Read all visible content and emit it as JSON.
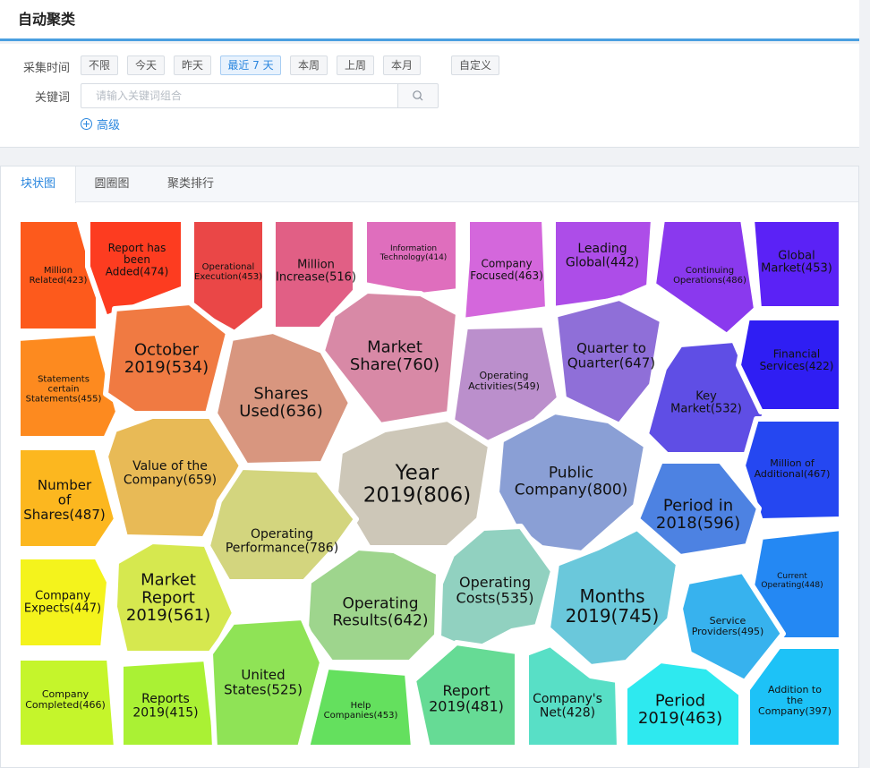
{
  "header": {
    "title": "自动聚类"
  },
  "filters": {
    "time_label": "采集时间",
    "time_options": [
      "不限",
      "今天",
      "昨天",
      "最近 7 天",
      "本周",
      "上周",
      "本月",
      "自定义"
    ],
    "selected_time": "最近 7 天",
    "keyword_label": "关键词",
    "keyword_placeholder": "请输入关键词组合",
    "keyword_value": "",
    "advanced_label": "高级"
  },
  "tabs": [
    {
      "label": "块状图",
      "active": true
    },
    {
      "label": "圆圈图",
      "active": false
    },
    {
      "label": "聚类排行",
      "active": false
    }
  ],
  "clusters": [
    {
      "label": "Million Related(423)",
      "count": 423,
      "color": "#fd5a1c"
    },
    {
      "label": "Report has been Added(474)",
      "count": 474,
      "color": "#fd3c20"
    },
    {
      "label": "Operational Execution(453)",
      "count": 453,
      "color": "#ea4747"
    },
    {
      "label": "Million Increase(516)",
      "count": 516,
      "color": "#e15f85"
    },
    {
      "label": "Information Technology(414)",
      "count": 414,
      "color": "#df6ebd"
    },
    {
      "label": "Company Focused(463)",
      "count": 463,
      "color": "#d467dc"
    },
    {
      "label": "Leading Global(442)",
      "count": 442,
      "color": "#ad4de8"
    },
    {
      "label": "Continuing Operations(486)",
      "count": 486,
      "color": "#8a39ee"
    },
    {
      "label": "Global Market(453)",
      "count": 453,
      "color": "#5b22f6"
    },
    {
      "label": "Statements certain Statements(455)",
      "count": 455,
      "color": "#fd8a1f"
    },
    {
      "label": "October 2019(534)",
      "count": 534,
      "color": "#f07a42"
    },
    {
      "label": "Shares Used(636)",
      "count": 636,
      "color": "#d8967f"
    },
    {
      "label": "Market Share(760)",
      "count": 760,
      "color": "#d889a6"
    },
    {
      "label": "Operating Activities(549)",
      "count": 549,
      "color": "#bb8fcc"
    },
    {
      "label": "Quarter to Quarter(647)",
      "count": 647,
      "color": "#8f6fd8"
    },
    {
      "label": "Key Market(532)",
      "count": 532,
      "color": "#5f4ee5"
    },
    {
      "label": "Financial Services(422)",
      "count": 422,
      "color": "#2f1ef3"
    },
    {
      "label": "Number of Shares(487)",
      "count": 487,
      "color": "#fcb71f"
    },
    {
      "label": "Value of the Company(659)",
      "count": 659,
      "color": "#e8ba56"
    },
    {
      "label": "Year 2019(806)",
      "count": 806,
      "color": "#cdc7b8"
    },
    {
      "label": "Public Company(800)",
      "count": 800,
      "color": "#8a9fd5"
    },
    {
      "label": "Million of Additional(467)",
      "count": 467,
      "color": "#2547f1"
    },
    {
      "label": "Operating Performance(786)",
      "count": 786,
      "color": "#d3d57e"
    },
    {
      "label": "Period in 2018(596)",
      "count": 596,
      "color": "#4d82e2"
    },
    {
      "label": "Company Expects(447)",
      "count": 447,
      "color": "#f4f31c"
    },
    {
      "label": "Market Report 2019(561)",
      "count": 561,
      "color": "#d6e84f"
    },
    {
      "label": "Operating Results(642)",
      "count": 642,
      "color": "#9ed58d"
    },
    {
      "label": "Operating Costs(535)",
      "count": 535,
      "color": "#91d1c0"
    },
    {
      "label": "Months 2019(745)",
      "count": 745,
      "color": "#6ac8db"
    },
    {
      "label": "Current Operating(448)",
      "count": 448,
      "color": "#2488f3"
    },
    {
      "label": "Service Providers(495)",
      "count": 495,
      "color": "#37b2ee"
    },
    {
      "label": "Company Completed(466)",
      "count": 466,
      "color": "#c5f52b"
    },
    {
      "label": "Reports 2019(415)",
      "count": 415,
      "color": "#aaf134"
    },
    {
      "label": "United States(525)",
      "count": 525,
      "color": "#8fe356"
    },
    {
      "label": "Help Companies(453)",
      "count": 453,
      "color": "#64e05e"
    },
    {
      "label": "Report 2019(481)",
      "count": 481,
      "color": "#66db95"
    },
    {
      "label": "Company's Net(428)",
      "count": 428,
      "color": "#58dfc6"
    },
    {
      "label": "Period 2019(463)",
      "count": 463,
      "color": "#2ee9ef"
    },
    {
      "label": "Addition to the Company(397)",
      "count": 397,
      "color": "#1dc2f7"
    }
  ]
}
